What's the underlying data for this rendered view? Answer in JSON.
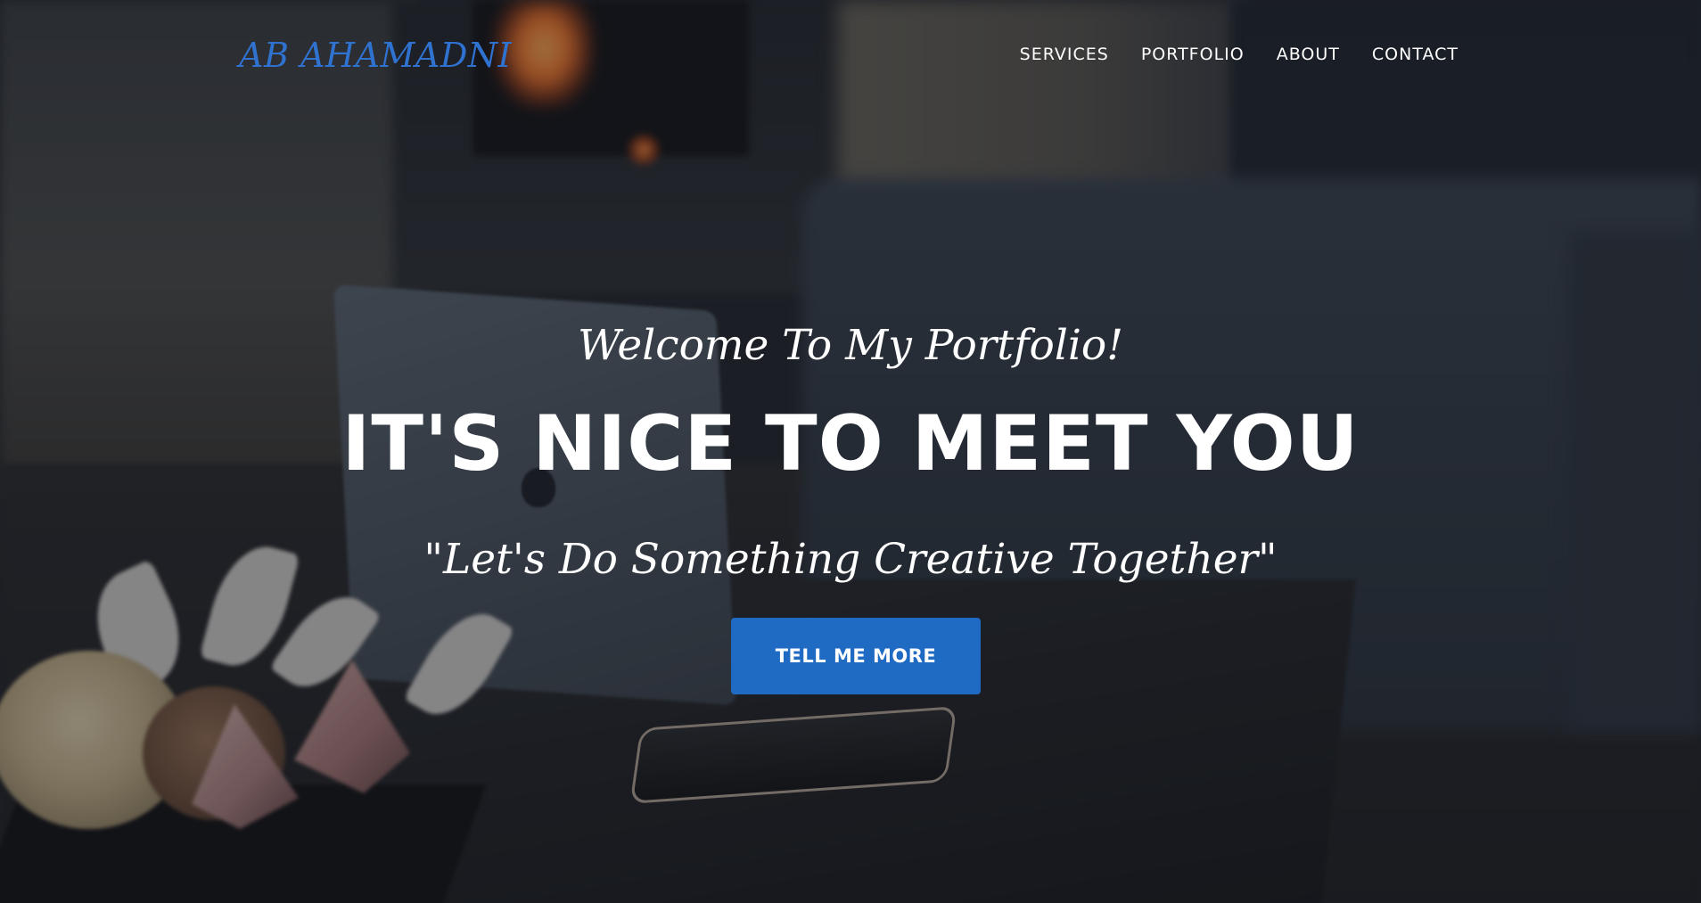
{
  "navbar": {
    "brand": "AB AHAMADNI",
    "links": [
      {
        "label": "SERVICES"
      },
      {
        "label": "PORTFOLIO"
      },
      {
        "label": "ABOUT"
      },
      {
        "label": "CONTACT"
      }
    ]
  },
  "hero": {
    "lead_in": "Welcome To My Portfolio!",
    "heading": "IT'S NICE TO MEET YOU",
    "tagline": "\"Let's Do Something Creative Together\"",
    "cta_label": "TELL ME MORE"
  },
  "colors": {
    "brand": "#2f72cf",
    "cta_background": "#1f6ac3",
    "text": "#ffffff"
  }
}
